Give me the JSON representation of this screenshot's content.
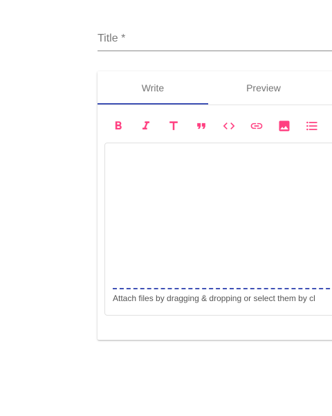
{
  "title_field": {
    "label": "Title *"
  },
  "tabs": [
    {
      "label": "Write",
      "active": true
    },
    {
      "label": "Preview",
      "active": false
    }
  ],
  "toolbar": {
    "icon_color": "#ff4081",
    "buttons": [
      {
        "icon": "bold-icon"
      },
      {
        "icon": "italic-icon"
      },
      {
        "icon": "header-icon"
      },
      {
        "icon": "quote-icon"
      },
      {
        "icon": "code-icon"
      },
      {
        "icon": "link-icon"
      },
      {
        "icon": "image-icon"
      },
      {
        "icon": "bulleted-list-icon"
      }
    ]
  },
  "editor": {
    "attach_hint": "Attach files by dragging & dropping or select them by cl"
  },
  "colors": {
    "accent": "#3f51b5",
    "icon": "#ff4081"
  }
}
